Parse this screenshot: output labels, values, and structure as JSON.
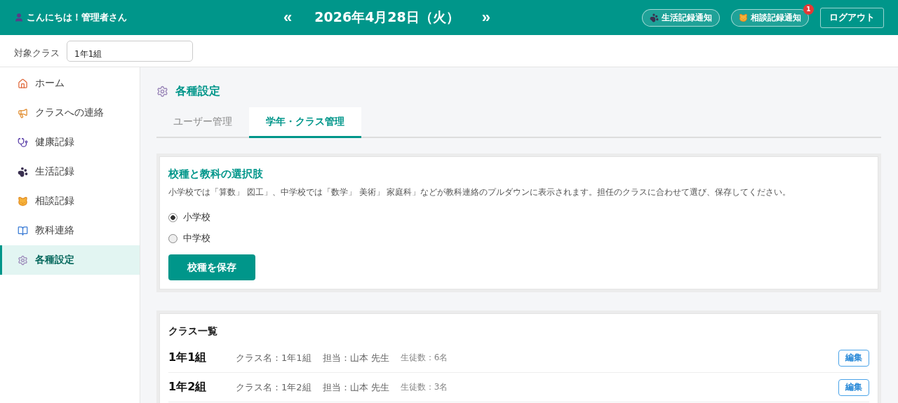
{
  "header": {
    "greeting": "こんにちは！管理者さん",
    "prev": "«",
    "date": "2026年4月28日（火）",
    "next": "»",
    "notices": [
      {
        "label": "生活記録通知",
        "kind": "paw"
      },
      {
        "label": "相談記録通知",
        "kind": "cat",
        "badge": "1"
      }
    ],
    "logout": "ログアウト"
  },
  "class_filter": {
    "label": "対象クラス",
    "value": "1年1組"
  },
  "sidebar": {
    "items": [
      {
        "label": "ホーム",
        "kind": "home",
        "selected": false
      },
      {
        "label": "クラスへの連絡",
        "kind": "megaphone",
        "selected": false
      },
      {
        "label": "健康記録",
        "kind": "stethoscope",
        "selected": false
      },
      {
        "label": "生活記録",
        "kind": "paw",
        "selected": false
      },
      {
        "label": "相談記録",
        "kind": "cat",
        "selected": false
      },
      {
        "label": "教科連絡",
        "kind": "book",
        "selected": false
      },
      {
        "label": "各種設定",
        "kind": "gear",
        "selected": true
      }
    ]
  },
  "page_title": "各種設定",
  "tabs": [
    {
      "label": "ユーザー管理",
      "selected": false
    },
    {
      "label": "学年・クラス管理",
      "selected": true
    }
  ],
  "school_card": {
    "title": "校種と教科の選択肢",
    "description": "小学校では「算数」 図工」、中学校では「数学」 美術」 家庭科」などが教科連絡のプルダウンに表示されます。担任のクラスに合わせて選び、保存してください。",
    "options": [
      {
        "label": "小学校",
        "selected": true
      },
      {
        "label": "中学校",
        "selected": false
      }
    ],
    "save": "校種を保存"
  },
  "class_list": {
    "title": "クラス一覧",
    "rows": [
      {
        "name": "1年1組",
        "class_name": "クラス名：1年1組",
        "teacher": "担当：山本 先生",
        "students": "生徒数：6名",
        "edit": "編集"
      },
      {
        "name": "1年2組",
        "class_name": "クラス名：1年2組",
        "teacher": "担当：山本 先生",
        "students": "生徒数：3名",
        "edit": "編集"
      }
    ]
  }
}
